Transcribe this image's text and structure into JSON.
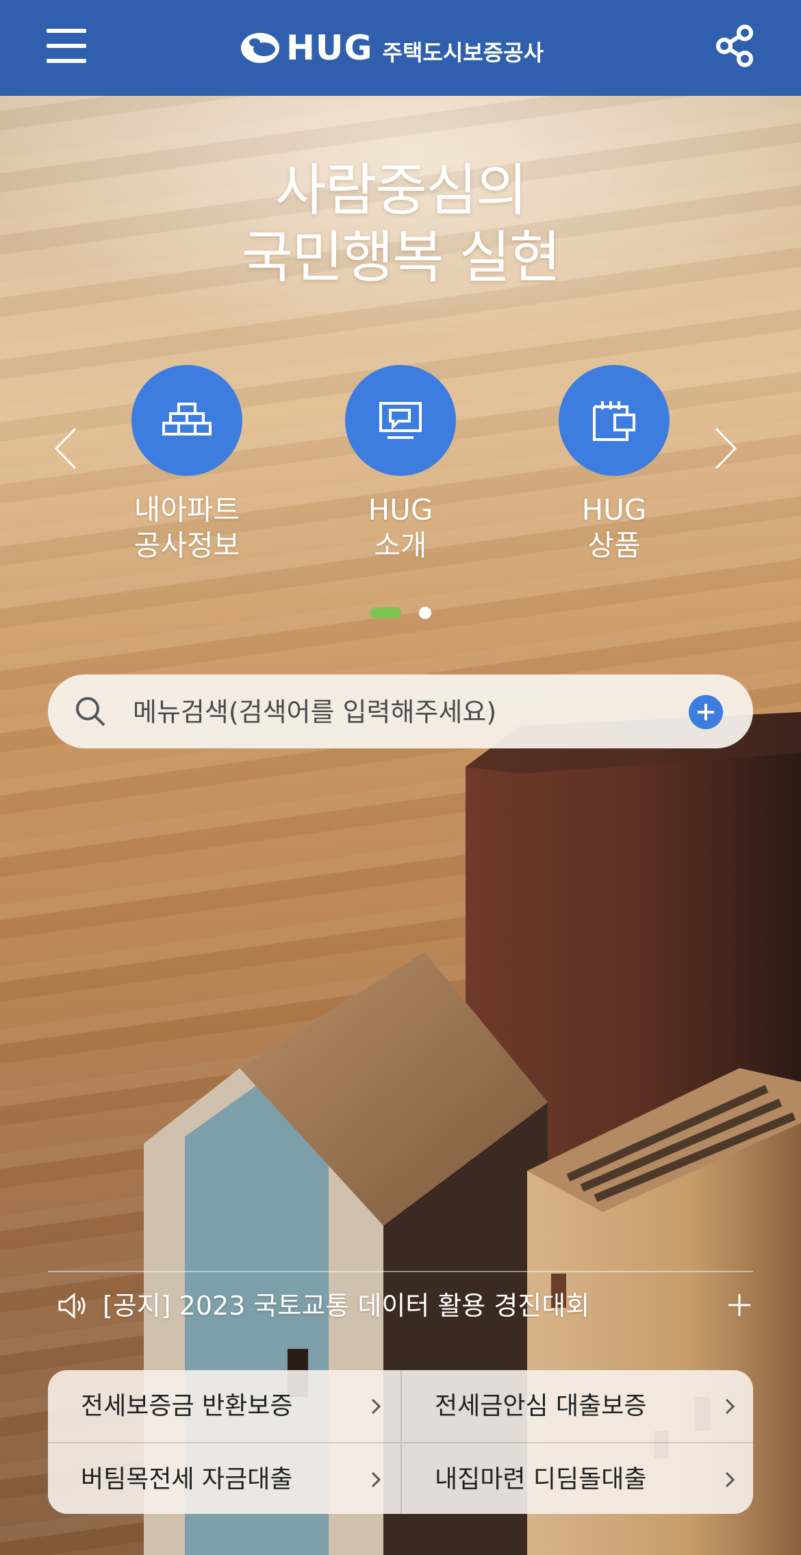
{
  "header": {
    "logo_text": "HUG",
    "logo_sub": "주택도시보증공사",
    "menu_icon": "hamburger-icon",
    "share_icon": "share-icon"
  },
  "hero": {
    "slogan_line1": "사람중심의",
    "slogan_line2": "국민행복 실현"
  },
  "quick_menu": {
    "items": [
      {
        "line1": "내아파트",
        "line2": "공사정보",
        "icon": "building-blocks-icon"
      },
      {
        "line1": "HUG",
        "line2": "소개",
        "icon": "chat-monitor-icon"
      },
      {
        "line1": "HUG",
        "line2": "상품",
        "icon": "calendar-wallet-icon"
      }
    ],
    "active_page": 1,
    "page_count": 2
  },
  "search": {
    "placeholder": "메뉴검색(검색어를 입력해주세요)",
    "value": ""
  },
  "notice": {
    "text": "[공지] 2023 국토교통 데이터 활용 경진대회",
    "icon": "speaker-icon"
  },
  "shortcuts": [
    {
      "label": "전세보증금 반환보증"
    },
    {
      "label": "전세금안심 대출보증"
    },
    {
      "label": "버팀목전세 자금대출"
    },
    {
      "label": "내집마련 디딤돌대출"
    }
  ],
  "colors": {
    "header_bg": "#3060ad",
    "accent_blue": "#3d7de0",
    "indicator_green": "#7cc451"
  }
}
